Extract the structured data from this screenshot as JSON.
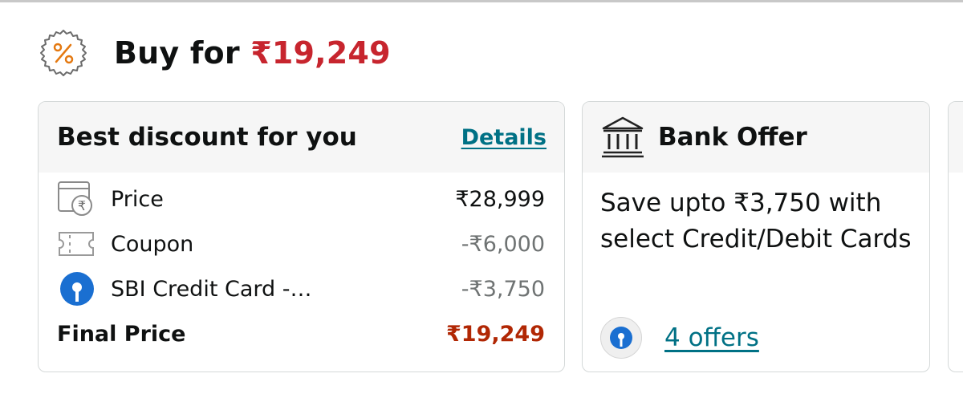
{
  "header": {
    "prefix": "Buy for",
    "price": "₹19,249",
    "icon": "discount-percent-badge-icon"
  },
  "best_discount": {
    "title": "Best discount for you",
    "details_link": "Details",
    "rows": [
      {
        "label": "Price",
        "value": "₹28,999",
        "icon": "price-tag-rupee-icon"
      },
      {
        "label": "Coupon",
        "value": "-₹6,000",
        "icon": "coupon-ticket-icon"
      },
      {
        "label": "SBI Credit Card -…",
        "value": "-₹3,750",
        "icon": "sbi-logo-icon"
      }
    ],
    "final": {
      "label": "Final Price",
      "value": "₹19,249"
    }
  },
  "bank_offer": {
    "title": "Bank Offer",
    "icon": "bank-building-icon",
    "description": "Save upto ₹3,750 with select Credit/Debit Cards",
    "offers_link": "4 offers"
  },
  "colors": {
    "price_red": "#c7252e",
    "final_price": "#b12704",
    "link_teal": "#007185",
    "card_header_bg": "#f6f6f6",
    "sbi_blue": "#1a6fd1"
  }
}
